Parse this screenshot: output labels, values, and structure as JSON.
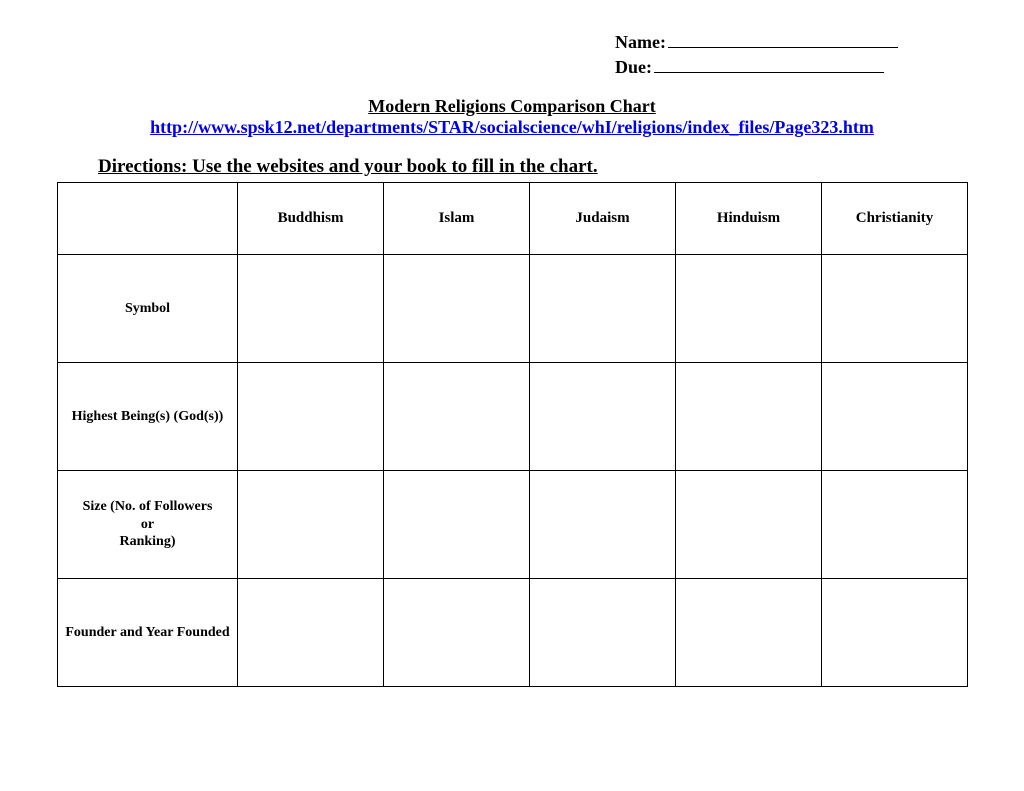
{
  "header": {
    "name_label": "Name:",
    "due_label": "Due:"
  },
  "title": "Modern Religions Comparison Chart",
  "url": "http://www.spsk12.net/departments/STAR/socialscience/whI/religions/index_files/Page323.htm",
  "directions": "Directions:  Use the websites and your book to fill in the chart.",
  "chart_data": {
    "type": "table",
    "columns": [
      "",
      "Buddhism",
      "Islam",
      "Judaism",
      "Hinduism",
      "Christianity"
    ],
    "rows": [
      {
        "label": "Symbol",
        "cells": [
          "",
          "",
          "",
          "",
          ""
        ]
      },
      {
        "label": "Highest Being(s) (God(s))",
        "cells": [
          "",
          "",
          "",
          "",
          ""
        ]
      },
      {
        "label": "Size (No. of Followers or Ranking)",
        "label_lines": [
          "Size (No. of Followers",
          "or",
          "Ranking)"
        ],
        "cells": [
          "",
          "",
          "",
          "",
          ""
        ]
      },
      {
        "label": "Founder and Year Founded",
        "cells": [
          "",
          "",
          "",
          "",
          ""
        ]
      }
    ]
  }
}
